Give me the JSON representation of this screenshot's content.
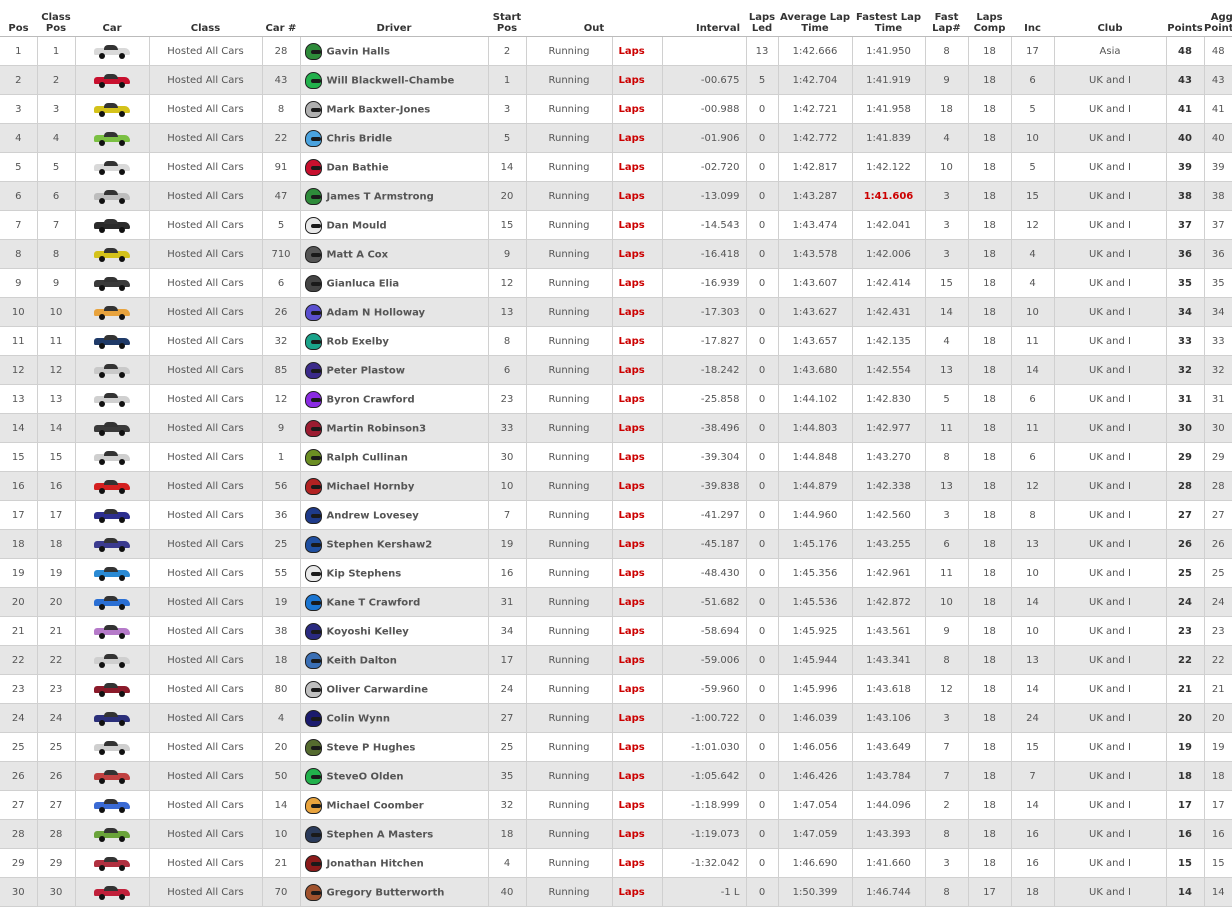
{
  "headers": {
    "pos": "Pos",
    "class_pos": "Class Pos",
    "car": "Car",
    "class": "Class",
    "car_num": "Car #",
    "driver": "Driver",
    "start_pos": "Start Pos",
    "out": "Out",
    "interval": "Interval",
    "laps_led": "Laps Led",
    "avg_lap": "Average Lap Time",
    "fastest_lap": "Fastest Lap Time",
    "fast_lap_num": "Fast Lap#",
    "laps_comp": "Laps Comp",
    "inc": "Inc",
    "club": "Club",
    "points": "Points",
    "agg_points": "Agg Points"
  },
  "rows": [
    {
      "pos": "1",
      "class_pos": "1",
      "car_color": "#d9d9d9",
      "class": "Hosted All Cars",
      "car_num": "28",
      "helmet": "#2e8b3a",
      "driver": "Gavin Halls",
      "start": "2",
      "status": "Running",
      "out": "Laps",
      "interval": "",
      "laps_led": "13",
      "avg": "1:42.666",
      "fastest": "1:41.950",
      "fastest_best": false,
      "fast_lap": "8",
      "laps_comp": "18",
      "inc": "17",
      "club": "Asia",
      "points": "48",
      "agg": "48"
    },
    {
      "pos": "2",
      "class_pos": "2",
      "car_color": "#c8102e",
      "class": "Hosted All Cars",
      "car_num": "43",
      "helmet": "#22b14c",
      "driver": "Will Blackwell-Chambe",
      "start": "1",
      "status": "Running",
      "out": "Laps",
      "interval": "-00.675",
      "laps_led": "5",
      "avg": "1:42.704",
      "fastest": "1:41.919",
      "fastest_best": false,
      "fast_lap": "9",
      "laps_comp": "18",
      "inc": "6",
      "club": "UK and I",
      "points": "43",
      "agg": "43"
    },
    {
      "pos": "3",
      "class_pos": "3",
      "car_color": "#d4c21a",
      "class": "Hosted All Cars",
      "car_num": "8",
      "helmet": "#b0b0b0",
      "driver": "Mark Baxter-Jones",
      "start": "3",
      "status": "Running",
      "out": "Laps",
      "interval": "-00.988",
      "laps_led": "0",
      "avg": "1:42.721",
      "fastest": "1:41.958",
      "fastest_best": false,
      "fast_lap": "18",
      "laps_comp": "18",
      "inc": "5",
      "club": "UK and I",
      "points": "41",
      "agg": "41"
    },
    {
      "pos": "4",
      "class_pos": "4",
      "car_color": "#7bc043",
      "class": "Hosted All Cars",
      "car_num": "22",
      "helmet": "#4aa3df",
      "driver": "Chris Bridle",
      "start": "5",
      "status": "Running",
      "out": "Laps",
      "interval": "-01.906",
      "laps_led": "0",
      "avg": "1:42.772",
      "fastest": "1:41.839",
      "fastest_best": false,
      "fast_lap": "4",
      "laps_comp": "18",
      "inc": "10",
      "club": "UK and I",
      "points": "40",
      "agg": "40"
    },
    {
      "pos": "5",
      "class_pos": "5",
      "car_color": "#d9d9d9",
      "class": "Hosted All Cars",
      "car_num": "91",
      "helmet": "#c8102e",
      "driver": "Dan Bathie",
      "start": "14",
      "status": "Running",
      "out": "Laps",
      "interval": "-02.720",
      "laps_led": "0",
      "avg": "1:42.817",
      "fastest": "1:42.122",
      "fastest_best": false,
      "fast_lap": "10",
      "laps_comp": "18",
      "inc": "5",
      "club": "UK and I",
      "points": "39",
      "agg": "39"
    },
    {
      "pos": "6",
      "class_pos": "6",
      "car_color": "#bdbdbd",
      "class": "Hosted All Cars",
      "car_num": "47",
      "helmet": "#2e8b3a",
      "driver": "James T Armstrong",
      "start": "20",
      "status": "Running",
      "out": "Laps",
      "interval": "-13.099",
      "laps_led": "0",
      "avg": "1:43.287",
      "fastest": "1:41.606",
      "fastest_best": true,
      "fast_lap": "3",
      "laps_comp": "18",
      "inc": "15",
      "club": "UK and I",
      "points": "38",
      "agg": "38"
    },
    {
      "pos": "7",
      "class_pos": "7",
      "car_color": "#2b2b2b",
      "class": "Hosted All Cars",
      "car_num": "5",
      "helmet": "#e8e8e8",
      "driver": "Dan Mould",
      "start": "15",
      "status": "Running",
      "out": "Laps",
      "interval": "-14.543",
      "laps_led": "0",
      "avg": "1:43.474",
      "fastest": "1:42.041",
      "fastest_best": false,
      "fast_lap": "3",
      "laps_comp": "18",
      "inc": "12",
      "club": "UK and I",
      "points": "37",
      "agg": "37"
    },
    {
      "pos": "8",
      "class_pos": "8",
      "car_color": "#d4c21a",
      "class": "Hosted All Cars",
      "car_num": "710",
      "helmet": "#555555",
      "driver": "Matt A Cox",
      "start": "9",
      "status": "Running",
      "out": "Laps",
      "interval": "-16.418",
      "laps_led": "0",
      "avg": "1:43.578",
      "fastest": "1:42.006",
      "fastest_best": false,
      "fast_lap": "3",
      "laps_comp": "18",
      "inc": "4",
      "club": "UK and I",
      "points": "36",
      "agg": "36"
    },
    {
      "pos": "9",
      "class_pos": "9",
      "car_color": "#3a3a3a",
      "class": "Hosted All Cars",
      "car_num": "6",
      "helmet": "#444444",
      "driver": "Gianluca Elia",
      "start": "12",
      "status": "Running",
      "out": "Laps",
      "interval": "-16.939",
      "laps_led": "0",
      "avg": "1:43.607",
      "fastest": "1:42.414",
      "fastest_best": false,
      "fast_lap": "15",
      "laps_comp": "18",
      "inc": "4",
      "club": "UK and I",
      "points": "35",
      "agg": "35"
    },
    {
      "pos": "10",
      "class_pos": "10",
      "car_color": "#e8a33d",
      "class": "Hosted All Cars",
      "car_num": "26",
      "helmet": "#5a4fcf",
      "driver": "Adam N Holloway",
      "start": "13",
      "status": "Running",
      "out": "Laps",
      "interval": "-17.303",
      "laps_led": "0",
      "avg": "1:43.627",
      "fastest": "1:42.431",
      "fastest_best": false,
      "fast_lap": "14",
      "laps_comp": "18",
      "inc": "10",
      "club": "UK and I",
      "points": "34",
      "agg": "34"
    },
    {
      "pos": "11",
      "class_pos": "11",
      "car_color": "#1f3a68",
      "class": "Hosted All Cars",
      "car_num": "32",
      "helmet": "#1aa38a",
      "driver": "Rob Exelby",
      "start": "8",
      "status": "Running",
      "out": "Laps",
      "interval": "-17.827",
      "laps_led": "0",
      "avg": "1:43.657",
      "fastest": "1:42.135",
      "fastest_best": false,
      "fast_lap": "4",
      "laps_comp": "18",
      "inc": "11",
      "club": "UK and I",
      "points": "33",
      "agg": "33"
    },
    {
      "pos": "12",
      "class_pos": "12",
      "car_color": "#c9c9c9",
      "class": "Hosted All Cars",
      "car_num": "85",
      "helmet": "#3b2a8a",
      "driver": "Peter Plastow",
      "start": "6",
      "status": "Running",
      "out": "Laps",
      "interval": "-18.242",
      "laps_led": "0",
      "avg": "1:43.680",
      "fastest": "1:42.554",
      "fastest_best": false,
      "fast_lap": "13",
      "laps_comp": "18",
      "inc": "14",
      "club": "UK and I",
      "points": "32",
      "agg": "32"
    },
    {
      "pos": "13",
      "class_pos": "13",
      "car_color": "#d0d0d0",
      "class": "Hosted All Cars",
      "car_num": "12",
      "helmet": "#8a2be2",
      "driver": "Byron Crawford",
      "start": "23",
      "status": "Running",
      "out": "Laps",
      "interval": "-25.858",
      "laps_led": "0",
      "avg": "1:44.102",
      "fastest": "1:42.830",
      "fastest_best": false,
      "fast_lap": "5",
      "laps_comp": "18",
      "inc": "6",
      "club": "UK and I",
      "points": "31",
      "agg": "31"
    },
    {
      "pos": "14",
      "class_pos": "14",
      "car_color": "#3a3a3a",
      "class": "Hosted All Cars",
      "car_num": "9",
      "helmet": "#9b1b30",
      "driver": "Martin Robinson3",
      "start": "33",
      "status": "Running",
      "out": "Laps",
      "interval": "-38.496",
      "laps_led": "0",
      "avg": "1:44.803",
      "fastest": "1:42.977",
      "fastest_best": false,
      "fast_lap": "11",
      "laps_comp": "18",
      "inc": "11",
      "club": "UK and I",
      "points": "30",
      "agg": "30"
    },
    {
      "pos": "15",
      "class_pos": "15",
      "car_color": "#cfcfcf",
      "class": "Hosted All Cars",
      "car_num": "1",
      "helmet": "#6b8e23",
      "driver": "Ralph Cullinan",
      "start": "30",
      "status": "Running",
      "out": "Laps",
      "interval": "-39.304",
      "laps_led": "0",
      "avg": "1:44.848",
      "fastest": "1:43.270",
      "fastest_best": false,
      "fast_lap": "8",
      "laps_comp": "18",
      "inc": "6",
      "club": "UK and I",
      "points": "29",
      "agg": "29"
    },
    {
      "pos": "16",
      "class_pos": "16",
      "car_color": "#d42020",
      "class": "Hosted All Cars",
      "car_num": "56",
      "helmet": "#b22222",
      "driver": "Michael Hornby",
      "start": "10",
      "status": "Running",
      "out": "Laps",
      "interval": "-39.838",
      "laps_led": "0",
      "avg": "1:44.879",
      "fastest": "1:42.338",
      "fastest_best": false,
      "fast_lap": "13",
      "laps_comp": "18",
      "inc": "12",
      "club": "UK and I",
      "points": "28",
      "agg": "28"
    },
    {
      "pos": "17",
      "class_pos": "17",
      "car_color": "#2d2f8f",
      "class": "Hosted All Cars",
      "car_num": "36",
      "helmet": "#1e3a8a",
      "driver": "Andrew Lovesey",
      "start": "7",
      "status": "Running",
      "out": "Laps",
      "interval": "-41.297",
      "laps_led": "0",
      "avg": "1:44.960",
      "fastest": "1:42.560",
      "fastest_best": false,
      "fast_lap": "3",
      "laps_comp": "18",
      "inc": "8",
      "club": "UK and I",
      "points": "27",
      "agg": "27"
    },
    {
      "pos": "18",
      "class_pos": "18",
      "car_color": "#3b3b8f",
      "class": "Hosted All Cars",
      "car_num": "25",
      "helmet": "#1f4fa0",
      "driver": "Stephen Kershaw2",
      "start": "19",
      "status": "Running",
      "out": "Laps",
      "interval": "-45.187",
      "laps_led": "0",
      "avg": "1:45.176",
      "fastest": "1:43.255",
      "fastest_best": false,
      "fast_lap": "6",
      "laps_comp": "18",
      "inc": "13",
      "club": "UK and I",
      "points": "26",
      "agg": "26"
    },
    {
      "pos": "19",
      "class_pos": "19",
      "car_color": "#2a8ad4",
      "class": "Hosted All Cars",
      "car_num": "55",
      "helmet": "#e8e8e8",
      "driver": "Kip Stephens",
      "start": "16",
      "status": "Running",
      "out": "Laps",
      "interval": "-48.430",
      "laps_led": "0",
      "avg": "1:45.356",
      "fastest": "1:42.961",
      "fastest_best": false,
      "fast_lap": "11",
      "laps_comp": "18",
      "inc": "10",
      "club": "UK and I",
      "points": "25",
      "agg": "25"
    },
    {
      "pos": "20",
      "class_pos": "20",
      "car_color": "#2a6fd4",
      "class": "Hosted All Cars",
      "car_num": "19",
      "helmet": "#1a75d1",
      "driver": "Kane T Crawford",
      "start": "31",
      "status": "Running",
      "out": "Laps",
      "interval": "-51.682",
      "laps_led": "0",
      "avg": "1:45.536",
      "fastest": "1:42.872",
      "fastest_best": false,
      "fast_lap": "10",
      "laps_comp": "18",
      "inc": "14",
      "club": "UK and I",
      "points": "24",
      "agg": "24"
    },
    {
      "pos": "21",
      "class_pos": "21",
      "car_color": "#b57ac9",
      "class": "Hosted All Cars",
      "car_num": "38",
      "helmet": "#2a2a80",
      "driver": "Koyoshi Kelley",
      "start": "34",
      "status": "Running",
      "out": "Laps",
      "interval": "-58.694",
      "laps_led": "0",
      "avg": "1:45.925",
      "fastest": "1:43.561",
      "fastest_best": false,
      "fast_lap": "9",
      "laps_comp": "18",
      "inc": "10",
      "club": "UK and I",
      "points": "23",
      "agg": "23"
    },
    {
      "pos": "22",
      "class_pos": "22",
      "car_color": "#cfcfcf",
      "class": "Hosted All Cars",
      "car_num": "18",
      "helmet": "#3a6fb5",
      "driver": "Keith Dalton",
      "start": "17",
      "status": "Running",
      "out": "Laps",
      "interval": "-59.006",
      "laps_led": "0",
      "avg": "1:45.944",
      "fastest": "1:43.341",
      "fastest_best": false,
      "fast_lap": "8",
      "laps_comp": "18",
      "inc": "13",
      "club": "UK and I",
      "points": "22",
      "agg": "22"
    },
    {
      "pos": "23",
      "class_pos": "23",
      "car_color": "#8b1a2a",
      "class": "Hosted All Cars",
      "car_num": "80",
      "helmet": "#c0c0c0",
      "driver": "Oliver Carwardine",
      "start": "24",
      "status": "Running",
      "out": "Laps",
      "interval": "-59.960",
      "laps_led": "0",
      "avg": "1:45.996",
      "fastest": "1:43.618",
      "fastest_best": false,
      "fast_lap": "12",
      "laps_comp": "18",
      "inc": "14",
      "club": "UK and I",
      "points": "21",
      "agg": "21"
    },
    {
      "pos": "24",
      "class_pos": "24",
      "car_color": "#2b2f7a",
      "class": "Hosted All Cars",
      "car_num": "4",
      "helmet": "#1a1a6e",
      "driver": "Colin Wynn",
      "start": "27",
      "status": "Running",
      "out": "Laps",
      "interval": "-1:00.722",
      "laps_led": "0",
      "avg": "1:46.039",
      "fastest": "1:43.106",
      "fastest_best": false,
      "fast_lap": "3",
      "laps_comp": "18",
      "inc": "24",
      "club": "UK and I",
      "points": "20",
      "agg": "20"
    },
    {
      "pos": "25",
      "class_pos": "25",
      "car_color": "#cfcfcf",
      "class": "Hosted All Cars",
      "car_num": "20",
      "helmet": "#556b2f",
      "driver": "Steve P Hughes",
      "start": "25",
      "status": "Running",
      "out": "Laps",
      "interval": "-1:01.030",
      "laps_led": "0",
      "avg": "1:46.056",
      "fastest": "1:43.649",
      "fastest_best": false,
      "fast_lap": "7",
      "laps_comp": "18",
      "inc": "15",
      "club": "UK and I",
      "points": "19",
      "agg": "19"
    },
    {
      "pos": "26",
      "class_pos": "26",
      "car_color": "#c04040",
      "class": "Hosted All Cars",
      "car_num": "50",
      "helmet": "#22b14c",
      "driver": "SteveO Olden",
      "start": "35",
      "status": "Running",
      "out": "Laps",
      "interval": "-1:05.642",
      "laps_led": "0",
      "avg": "1:46.426",
      "fastest": "1:43.784",
      "fastest_best": false,
      "fast_lap": "7",
      "laps_comp": "18",
      "inc": "7",
      "club": "UK and I",
      "points": "18",
      "agg": "18"
    },
    {
      "pos": "27",
      "class_pos": "27",
      "car_color": "#3a6ad4",
      "class": "Hosted All Cars",
      "car_num": "14",
      "helmet": "#e8a33d",
      "driver": "Michael Coomber",
      "start": "32",
      "status": "Running",
      "out": "Laps",
      "interval": "-1:18.999",
      "laps_led": "0",
      "avg": "1:47.054",
      "fastest": "1:44.096",
      "fastest_best": false,
      "fast_lap": "2",
      "laps_comp": "18",
      "inc": "14",
      "club": "UK and I",
      "points": "17",
      "agg": "17"
    },
    {
      "pos": "28",
      "class_pos": "28",
      "car_color": "#6aa33a",
      "class": "Hosted All Cars",
      "car_num": "10",
      "helmet": "#2a3a5a",
      "driver": "Stephen A Masters",
      "start": "18",
      "status": "Running",
      "out": "Laps",
      "interval": "-1:19.073",
      "laps_led": "0",
      "avg": "1:47.059",
      "fastest": "1:43.393",
      "fastest_best": false,
      "fast_lap": "8",
      "laps_comp": "18",
      "inc": "16",
      "club": "UK and I",
      "points": "16",
      "agg": "16"
    },
    {
      "pos": "29",
      "class_pos": "29",
      "car_color": "#b03040",
      "class": "Hosted All Cars",
      "car_num": "21",
      "helmet": "#8b1a1a",
      "driver": "Jonathan Hitchen",
      "start": "4",
      "status": "Running",
      "out": "Laps",
      "interval": "-1:32.042",
      "laps_led": "0",
      "avg": "1:46.690",
      "fastest": "1:41.660",
      "fastest_best": false,
      "fast_lap": "3",
      "laps_comp": "18",
      "inc": "16",
      "club": "UK and I",
      "points": "15",
      "agg": "15"
    },
    {
      "pos": "30",
      "class_pos": "30",
      "car_color": "#c0203a",
      "class": "Hosted All Cars",
      "car_num": "70",
      "helmet": "#a0522d",
      "driver": "Gregory Butterworth",
      "start": "40",
      "status": "Running",
      "out": "Laps",
      "interval": "-1 L",
      "laps_led": "0",
      "avg": "1:50.399",
      "fastest": "1:46.744",
      "fastest_best": false,
      "fast_lap": "8",
      "laps_comp": "17",
      "inc": "18",
      "club": "UK and I",
      "points": "14",
      "agg": "14"
    }
  ]
}
